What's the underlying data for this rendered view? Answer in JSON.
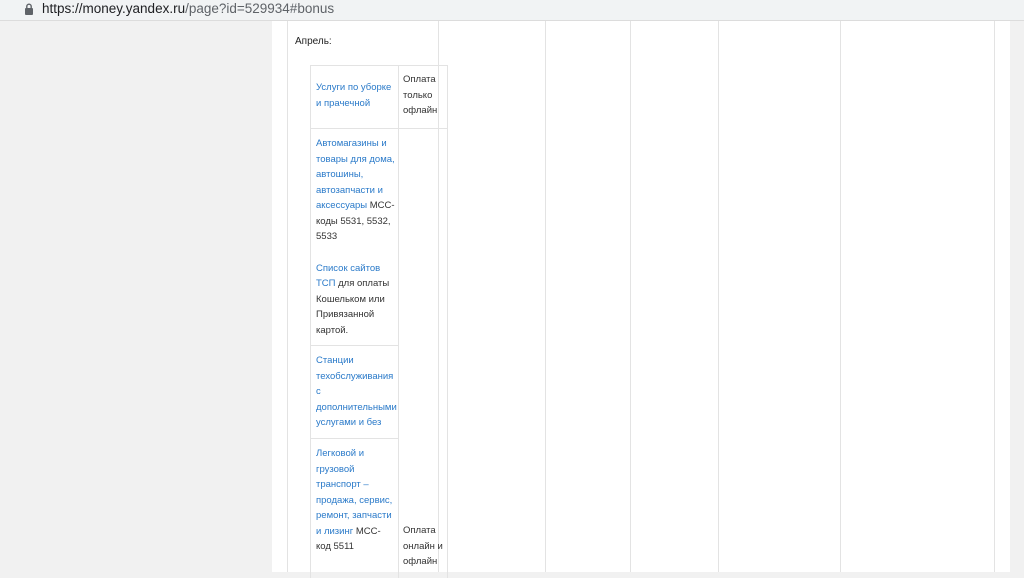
{
  "browser": {
    "url_main": "https://money.yandex.ru",
    "url_rest": "/page?id=529934#bonus"
  },
  "content": {
    "month_label": "Апрель:",
    "rows": [
      {
        "category": "Услуги по уборке и прачечной",
        "payment": "Оплата только офлайн"
      },
      {
        "category": "Автомагазины и товары для дома, автошины, автозапчасти и аксессуары",
        "mcc": "MCC-коды 5531, 5532, 5533",
        "sites_link": "Список сайтов ТСП",
        "sites_note": " для оплаты Кошельком или Привязанной картой."
      },
      {
        "category": "Станции техобслуживания с дополнительными услугами и без"
      },
      {
        "category": "Легковой и грузовой транспорт – продажа, сервис, ремонт, запчасти и лизинг",
        "mcc": "MCC-код 5511",
        "payment": "Оплата онлайн и офлайн"
      }
    ]
  },
  "colors": {
    "link": "#2a7ac9",
    "text": "#333333",
    "border": "#e3e3e3",
    "page_bg": "#f1f1f1"
  }
}
